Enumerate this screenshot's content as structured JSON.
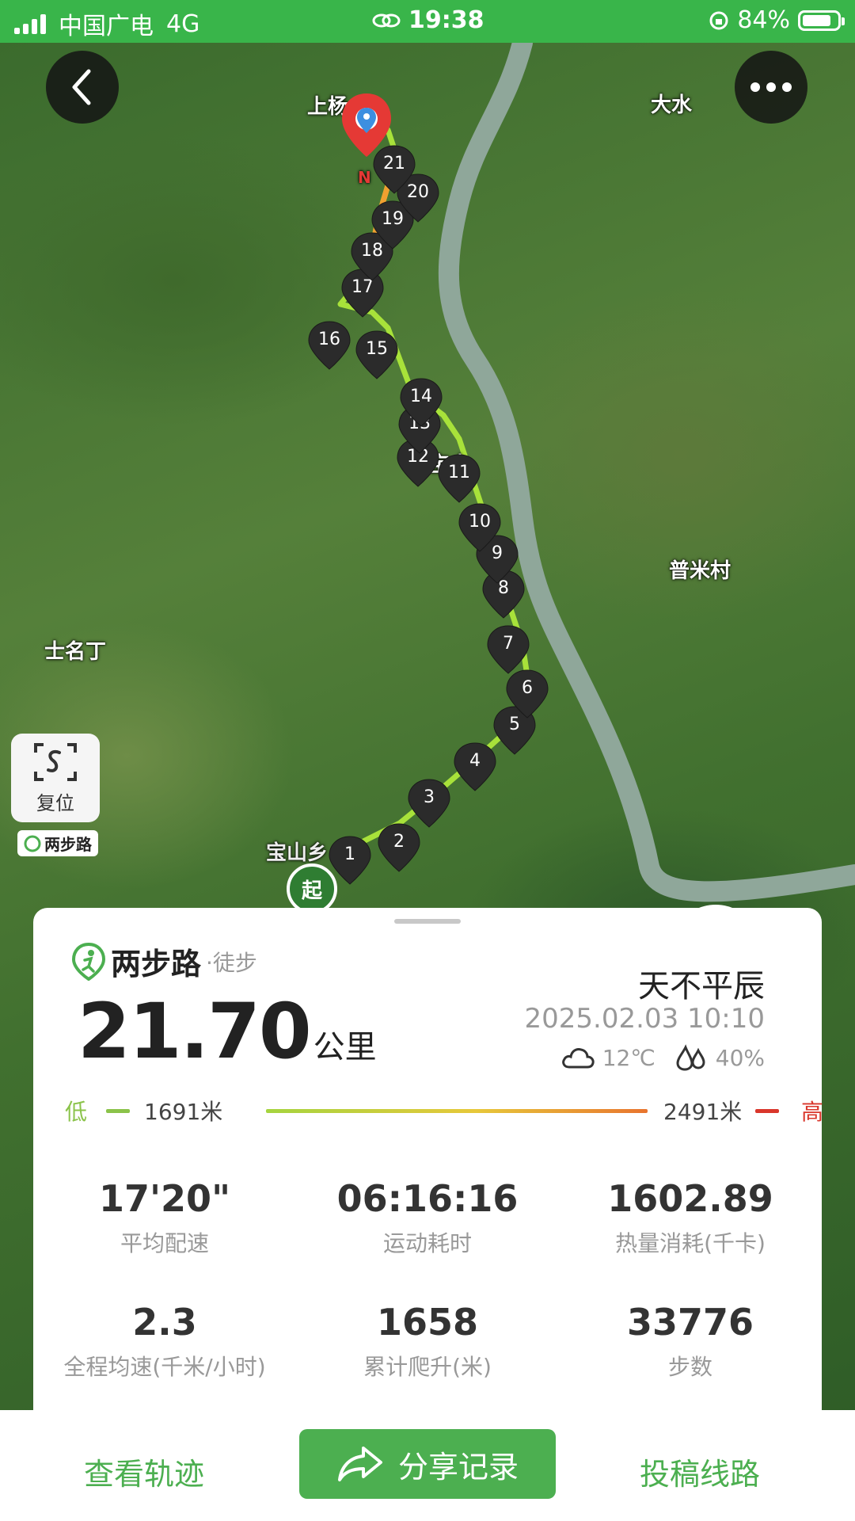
{
  "status": {
    "carrier": "中国广电",
    "network": "4G",
    "time": "19:38",
    "battery": "84%",
    "battery_level": 0.84
  },
  "map": {
    "labels": {
      "shangxing": "上杨",
      "dashui": "大水",
      "baodi": "宝山",
      "pumicun": "普米村",
      "shimingding": "士名丁",
      "baoshan_bottom": "宝山乡",
      "north_marker": "N"
    },
    "reset_label": "复位",
    "brand_badge": "两步路",
    "start_label": "起",
    "waypoints": [
      "1",
      "2",
      "3",
      "4",
      "5",
      "6",
      "7",
      "8",
      "9",
      "10",
      "11",
      "12",
      "13",
      "14",
      "15",
      "16",
      "17",
      "18",
      "19",
      "20",
      "21"
    ]
  },
  "card": {
    "brand": "两步路",
    "activity": "·徒步",
    "distance": "21.70",
    "distance_unit": "公里",
    "username": "天不平辰",
    "datetime": "2025.02.03 10:10",
    "temperature": "12℃",
    "humidity": "40%",
    "elevation": {
      "low_label": "低",
      "low_value": "1691米",
      "high_value": "2491米",
      "high_label": "高"
    },
    "stats": [
      {
        "value": "17'20\"",
        "label": "平均配速"
      },
      {
        "value": "06:16:16",
        "label": "运动耗时"
      },
      {
        "value": "1602.89",
        "label": "热量消耗(千卡)"
      },
      {
        "value": "2.3",
        "label": "全程均速(千米/小时)"
      },
      {
        "value": "1658",
        "label": "累计爬升(米)"
      },
      {
        "value": "33776",
        "label": "步数"
      }
    ]
  },
  "bottom": {
    "view_track": "查看轨迹",
    "share": "分享记录",
    "submit_route": "投稿线路"
  },
  "colors": {
    "brand_green": "#4caf50",
    "status_green": "#39b54a",
    "high_red": "#d9362b",
    "low_green": "#8bc34a"
  }
}
